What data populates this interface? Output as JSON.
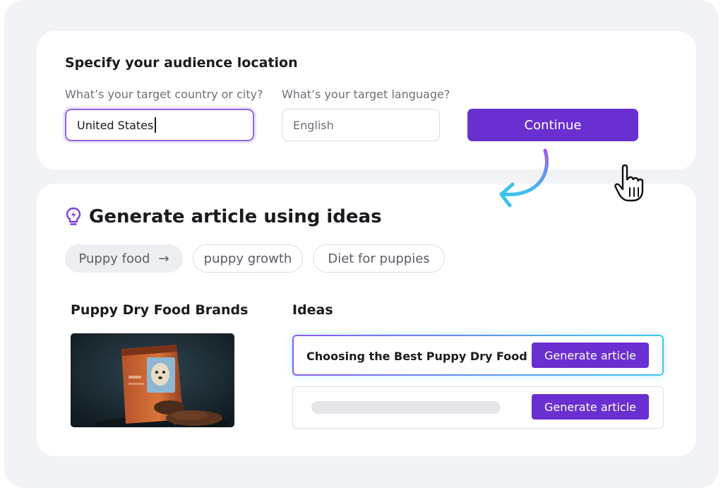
{
  "audience": {
    "title": "Specify your audience location",
    "country_label": "What’s your target country or city?",
    "country_value": "United States",
    "language_label": "What’s your target language?",
    "language_placeholder": "English",
    "continue_label": "Continue"
  },
  "generate": {
    "title": "Generate article using ideas",
    "chips": [
      {
        "label": "Puppy food",
        "icon": "arrow-right-icon",
        "selected": true
      },
      {
        "label": "puppy growth",
        "selected": false
      },
      {
        "label": "Diet for puppies",
        "selected": false
      }
    ],
    "product_heading": "Puppy Dry Food Brands",
    "ideas_heading": "Ideas",
    "ideas": [
      {
        "title": "Choosing the Best Puppy Dry Food",
        "button": "Generate article",
        "highlighted": true
      },
      {
        "title": "",
        "loading": true,
        "button": "Generate article"
      }
    ]
  },
  "colors": {
    "accent": "#6a2fd0",
    "focus_border": "#8f66ea",
    "gradient_start": "#8a5cf0",
    "gradient_end": "#3fc7ee",
    "background": "#f1f3f7"
  },
  "icons": [
    "lightbulb-icon",
    "arrow-right-icon",
    "curved-arrow-icon",
    "hand-cursor-icon"
  ]
}
